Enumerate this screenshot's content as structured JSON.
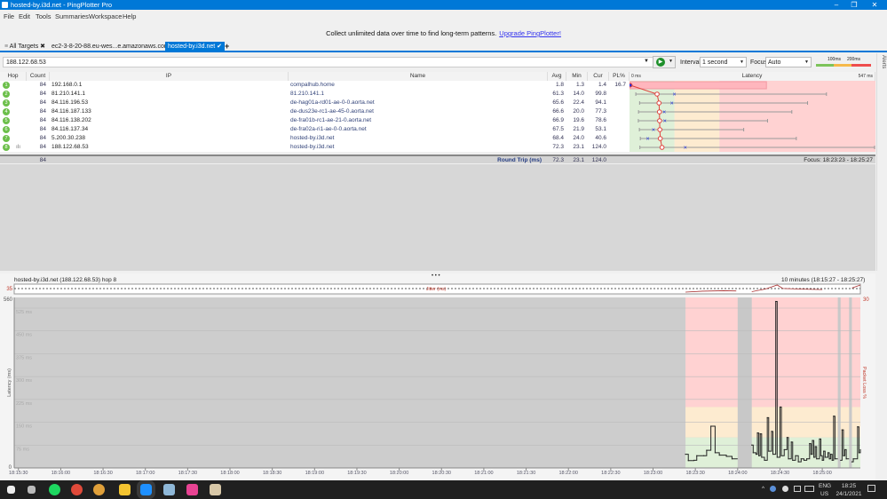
{
  "window": {
    "title": "hosted-by.i3d.net - PingPlotter Pro",
    "controls": [
      "–",
      "❐",
      "✕"
    ]
  },
  "menu": [
    "File",
    "Edit",
    "Tools",
    "Summaries",
    "Workspace",
    "Help"
  ],
  "banner": {
    "text": "Collect unlimited data over time to find long-term patterns.",
    "link": "Upgrade PingPlotter!"
  },
  "tabs": [
    {
      "label": "All Targets",
      "icon": "list-icon",
      "close": "✖"
    },
    {
      "label": "ec2-3-8-20-88.eu-wes...e.amazonaws.com",
      "check": "✔"
    },
    {
      "label": "hosted-by.i3d.net",
      "check": "✔",
      "active": true
    }
  ],
  "tab_add": "+",
  "toolbar": {
    "address": "188.122.68.53",
    "interval_label": "Interval",
    "interval_value": "1 second",
    "focus_label": "Focus",
    "focus_value": "Auto",
    "legend_100": "100ms",
    "legend_200": "200ms",
    "alerts": "Alerts"
  },
  "columns": {
    "hop": "Hop",
    "count": "Count",
    "ip": "IP",
    "name": "Name",
    "avg": "Avg",
    "min": "Min",
    "cur": "Cur",
    "pl": "PL%",
    "graph": "Latency",
    "graph_min": "0 ms",
    "graph_max": "547 ms"
  },
  "hops": [
    {
      "hop": "1",
      "count": "84",
      "ip": "192.168.0.1",
      "name": "compalhub.home",
      "avg": "1.8",
      "min": "1.3",
      "cur": "1.4",
      "pl": "16.7",
      "max": 1.8
    },
    {
      "hop": "2",
      "count": "84",
      "ip": "81.210.141.1",
      "name": "81.210.141.1",
      "avg": "61.3",
      "min": "14.0",
      "cur": "99.8",
      "pl": "",
      "max": 438
    },
    {
      "hop": "3",
      "count": "84",
      "ip": "84.116.196.53",
      "name": "de-hag01a-rd01-ae-0-0.aorta.net",
      "avg": "65.6",
      "min": "22.4",
      "cur": "94.1",
      "pl": "",
      "max": 396
    },
    {
      "hop": "4",
      "count": "84",
      "ip": "84.116.187.133",
      "name": "de-dus23e-rc1-ae-45-0.aorta.net",
      "avg": "66.6",
      "min": "20.0",
      "cur": "77.3",
      "pl": "",
      "max": 361
    },
    {
      "hop": "5",
      "count": "84",
      "ip": "84.116.138.202",
      "name": "de-fra01b-rc1-ae-21-0.aorta.net",
      "avg": "66.9",
      "min": "19.6",
      "cur": "78.6",
      "pl": "",
      "max": 307
    },
    {
      "hop": "6",
      "count": "84",
      "ip": "84.116.137.34",
      "name": "de-fra02a-ri1-ae-0-0.aorta.net",
      "avg": "67.5",
      "min": "21.9",
      "cur": "53.1",
      "pl": "",
      "max": 254
    },
    {
      "hop": "7",
      "count": "84",
      "ip": "5.200.30.238",
      "name": "hosted-by.i3d.net",
      "avg": "68.4",
      "min": "24.0",
      "cur": "40.6",
      "pl": "",
      "max": 371
    },
    {
      "hop": "8",
      "count": "84",
      "ip": "188.122.68.53",
      "name": "hosted-by.i3d.net",
      "avg": "72.3",
      "min": "23.1",
      "cur": "124.0",
      "pl": "",
      "max": 545
    }
  ],
  "summary": {
    "count": "84",
    "label": "Round Trip (ms)",
    "avg": "72.3",
    "min": "23.1",
    "cur": "124.0",
    "focus": "Focus: 18:23:23 - 18:25:27"
  },
  "graph_header": {
    "title": "hosted-by.i3d.net (188.122.68.53) hop 8",
    "range": "10 minutes (18:15:27 - 18:25:27)",
    "splitter": "• • •"
  },
  "colors": {
    "accent": "#0078d7",
    "good": "#dff0d8",
    "warn": "#fdebd0",
    "bad": "#ffd2d2",
    "loss_gap": "#c8c8c8",
    "line": "#222222"
  },
  "chart_data": {
    "type": "line",
    "title": "",
    "ylabel": "Latency (ms)",
    "y2label": "Packet Loss %",
    "ylim": [
      0,
      560
    ],
    "y2lim": [
      0,
      30
    ],
    "xlim": [
      "18:15:27",
      "18:25:27"
    ],
    "thresholds_ms": [
      100,
      200
    ],
    "ytick_labels": [
      "525 ms",
      "450 ms",
      "375 ms",
      "300 ms",
      "225 ms",
      "150 ms",
      "75 ms"
    ],
    "yticks": [
      525,
      450,
      375,
      300,
      225,
      150,
      75
    ],
    "y_end_labels": {
      "top": "560",
      "bottom": "0",
      "right_top": "30"
    },
    "xtick_labels": [
      "18:15:30",
      "18:16:00",
      "18:16:30",
      "18:17:00",
      "18:17:30",
      "18:18:00",
      "18:18:30",
      "18:19:00",
      "18:19:30",
      "18:20:00",
      "18:20:30",
      "18:21:00",
      "18:21:30",
      "18:22:00",
      "18:22:30",
      "18:23:00",
      "18:23:30",
      "18:24:00",
      "18:24:30",
      "18:25:00"
    ],
    "focus_start": "18:23:23",
    "packet_loss_periods": [
      [
        "18:24:00",
        "18:24:10"
      ],
      [
        "18:25:11",
        "18:25:13"
      ],
      [
        "18:25:19",
        "18:25:21"
      ]
    ],
    "latency": [
      [
        "18:23:23",
        45
      ],
      [
        "18:23:25",
        24
      ],
      [
        "18:23:29",
        25
      ],
      [
        "18:23:31",
        40
      ],
      [
        "18:23:36",
        40
      ],
      [
        "18:23:38",
        58
      ],
      [
        "18:23:41",
        137
      ],
      [
        "18:23:44",
        50
      ],
      [
        "18:23:47",
        42
      ],
      [
        "18:23:52",
        38
      ],
      [
        "18:23:56",
        30
      ],
      [
        "18:24:00",
        null
      ],
      [
        "18:24:10",
        75
      ],
      [
        "18:24:11",
        50
      ],
      [
        "18:24:13",
        45
      ],
      [
        "18:24:14",
        115
      ],
      [
        "18:24:15",
        40
      ],
      [
        "18:24:16",
        112
      ],
      [
        "18:24:17",
        35
      ],
      [
        "18:24:19",
        25
      ],
      [
        "18:24:21",
        165
      ],
      [
        "18:24:22",
        55
      ],
      [
        "18:24:24",
        120
      ],
      [
        "18:24:25",
        45
      ],
      [
        "18:24:27",
        547
      ],
      [
        "18:24:28",
        35
      ],
      [
        "18:24:30",
        200
      ],
      [
        "18:24:31",
        40
      ],
      [
        "18:24:33",
        60
      ],
      [
        "18:24:35",
        100
      ],
      [
        "18:24:36",
        30
      ],
      [
        "18:24:38",
        85
      ],
      [
        "18:24:39",
        25
      ],
      [
        "18:24:41",
        40
      ],
      [
        "18:24:43",
        20
      ],
      [
        "18:24:45",
        30
      ],
      [
        "18:24:47",
        25
      ],
      [
        "18:24:49",
        30
      ],
      [
        "18:24:51",
        80
      ],
      [
        "18:24:52",
        45
      ],
      [
        "18:24:53",
        90
      ],
      [
        "18:24:54",
        35
      ],
      [
        "18:24:55",
        70
      ],
      [
        "18:24:56",
        30
      ],
      [
        "18:24:58",
        95
      ],
      [
        "18:24:59",
        40
      ],
      [
        "18:25:00",
        25
      ],
      [
        "18:25:01",
        55
      ],
      [
        "18:25:02",
        35
      ],
      [
        "18:25:04",
        50
      ],
      [
        "18:25:05",
        30
      ],
      [
        "18:25:06",
        45
      ],
      [
        "18:25:07",
        25
      ],
      [
        "18:25:08",
        170
      ],
      [
        "18:25:09",
        30
      ],
      [
        "18:25:11",
        null
      ],
      [
        "18:25:13",
        25
      ],
      [
        "18:25:14",
        125
      ],
      [
        "18:25:15",
        40
      ],
      [
        "18:25:16",
        60
      ],
      [
        "18:25:17",
        30
      ],
      [
        "18:25:19",
        null
      ],
      [
        "18:25:21",
        20
      ],
      [
        "18:25:22",
        30
      ],
      [
        "18:25:25",
        135
      ],
      [
        "18:25:26",
        50
      ],
      [
        "18:25:27",
        60
      ]
    ],
    "jitter": {
      "label": "Jitter (ms)",
      "scale_max": "35",
      "points": [
        [
          "18:23:23",
          4
        ],
        [
          "18:23:35",
          8
        ],
        [
          "18:23:50",
          10
        ],
        [
          "18:23:59",
          9
        ],
        [
          "18:24:00",
          null
        ],
        [
          "18:24:10",
          6
        ],
        [
          "18:24:20",
          18
        ],
        [
          "18:24:28",
          35
        ],
        [
          "18:24:32",
          20
        ],
        [
          "18:24:45",
          17
        ],
        [
          "18:25:00",
          15
        ],
        [
          "18:25:11",
          null
        ],
        [
          "18:25:13",
          20
        ],
        [
          "18:25:19",
          null
        ],
        [
          "18:25:21",
          22
        ],
        [
          "18:25:27",
          35
        ]
      ]
    }
  },
  "taskbar": {
    "apps": [
      "start-icon",
      "task-view-icon",
      "spotify-icon",
      "chrome-icon",
      "chrome-profile-icon",
      "file-explorer-icon",
      "pingplotter-icon",
      "notepad-icon",
      "paint3d-icon",
      "paint-icon"
    ],
    "lang": "ENG",
    "region": "US",
    "time": "18:25",
    "date": "24/1/2021",
    "tray_chevron": "^"
  }
}
